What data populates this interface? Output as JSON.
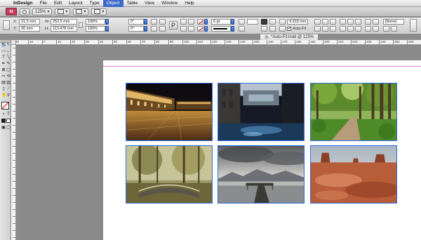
{
  "menubar": {
    "apple": "",
    "items": [
      "InDesign",
      "File",
      "Edit",
      "Layout",
      "Type",
      "Object",
      "Table",
      "View",
      "Window",
      "Help"
    ],
    "active": "Object"
  },
  "appbar": {
    "app_icon": "Id",
    "zoom": "125%"
  },
  "control": {
    "x_label": "X:",
    "x_value": "21.5 mm",
    "y_label": "Y:",
    "y_value": "30 mm",
    "w_label": "W:",
    "w_value": "252.5 mm",
    "h_label": "H:",
    "h_value": "113.478 mm",
    "scale_x": "100%",
    "scale_y": "100%",
    "rotate": "0°",
    "shear": "0°",
    "stroke_weight": "0 pt",
    "gap": "4.233 mm",
    "fitting": "[None]",
    "autofit_label": "Auto-Fit",
    "autofit_checked": true
  },
  "document": {
    "tab_label": "*Auto-Fit.indd @ 125%"
  },
  "ruler": {
    "ticks": [
      "20",
      "10",
      "0",
      "10",
      "20",
      "30",
      "40",
      "50",
      "60",
      "70",
      "80",
      "90",
      "100",
      "110",
      "120",
      "130",
      "140",
      "150",
      "160",
      "170",
      "180",
      "190",
      "200",
      "210",
      "220",
      "230",
      "240",
      "250",
      "260"
    ]
  },
  "photos": [
    {
      "name": "venice-piazza-night",
      "subject": "night piazza"
    },
    {
      "name": "bridge-of-sighs",
      "subject": "canal bridge"
    },
    {
      "name": "forest-path",
      "subject": "green forest path"
    },
    {
      "name": "forest-bridge",
      "subject": "autumn forest bridge"
    },
    {
      "name": "lake-pier",
      "subject": "lake pier"
    },
    {
      "name": "monument-valley",
      "subject": "desert buttes"
    }
  ],
  "colors": {
    "selection": "#2f6de0",
    "menu_active": "#3d6cc8",
    "pasteboard": "#8a8a8a",
    "margin_guide": "#d97bd9"
  }
}
